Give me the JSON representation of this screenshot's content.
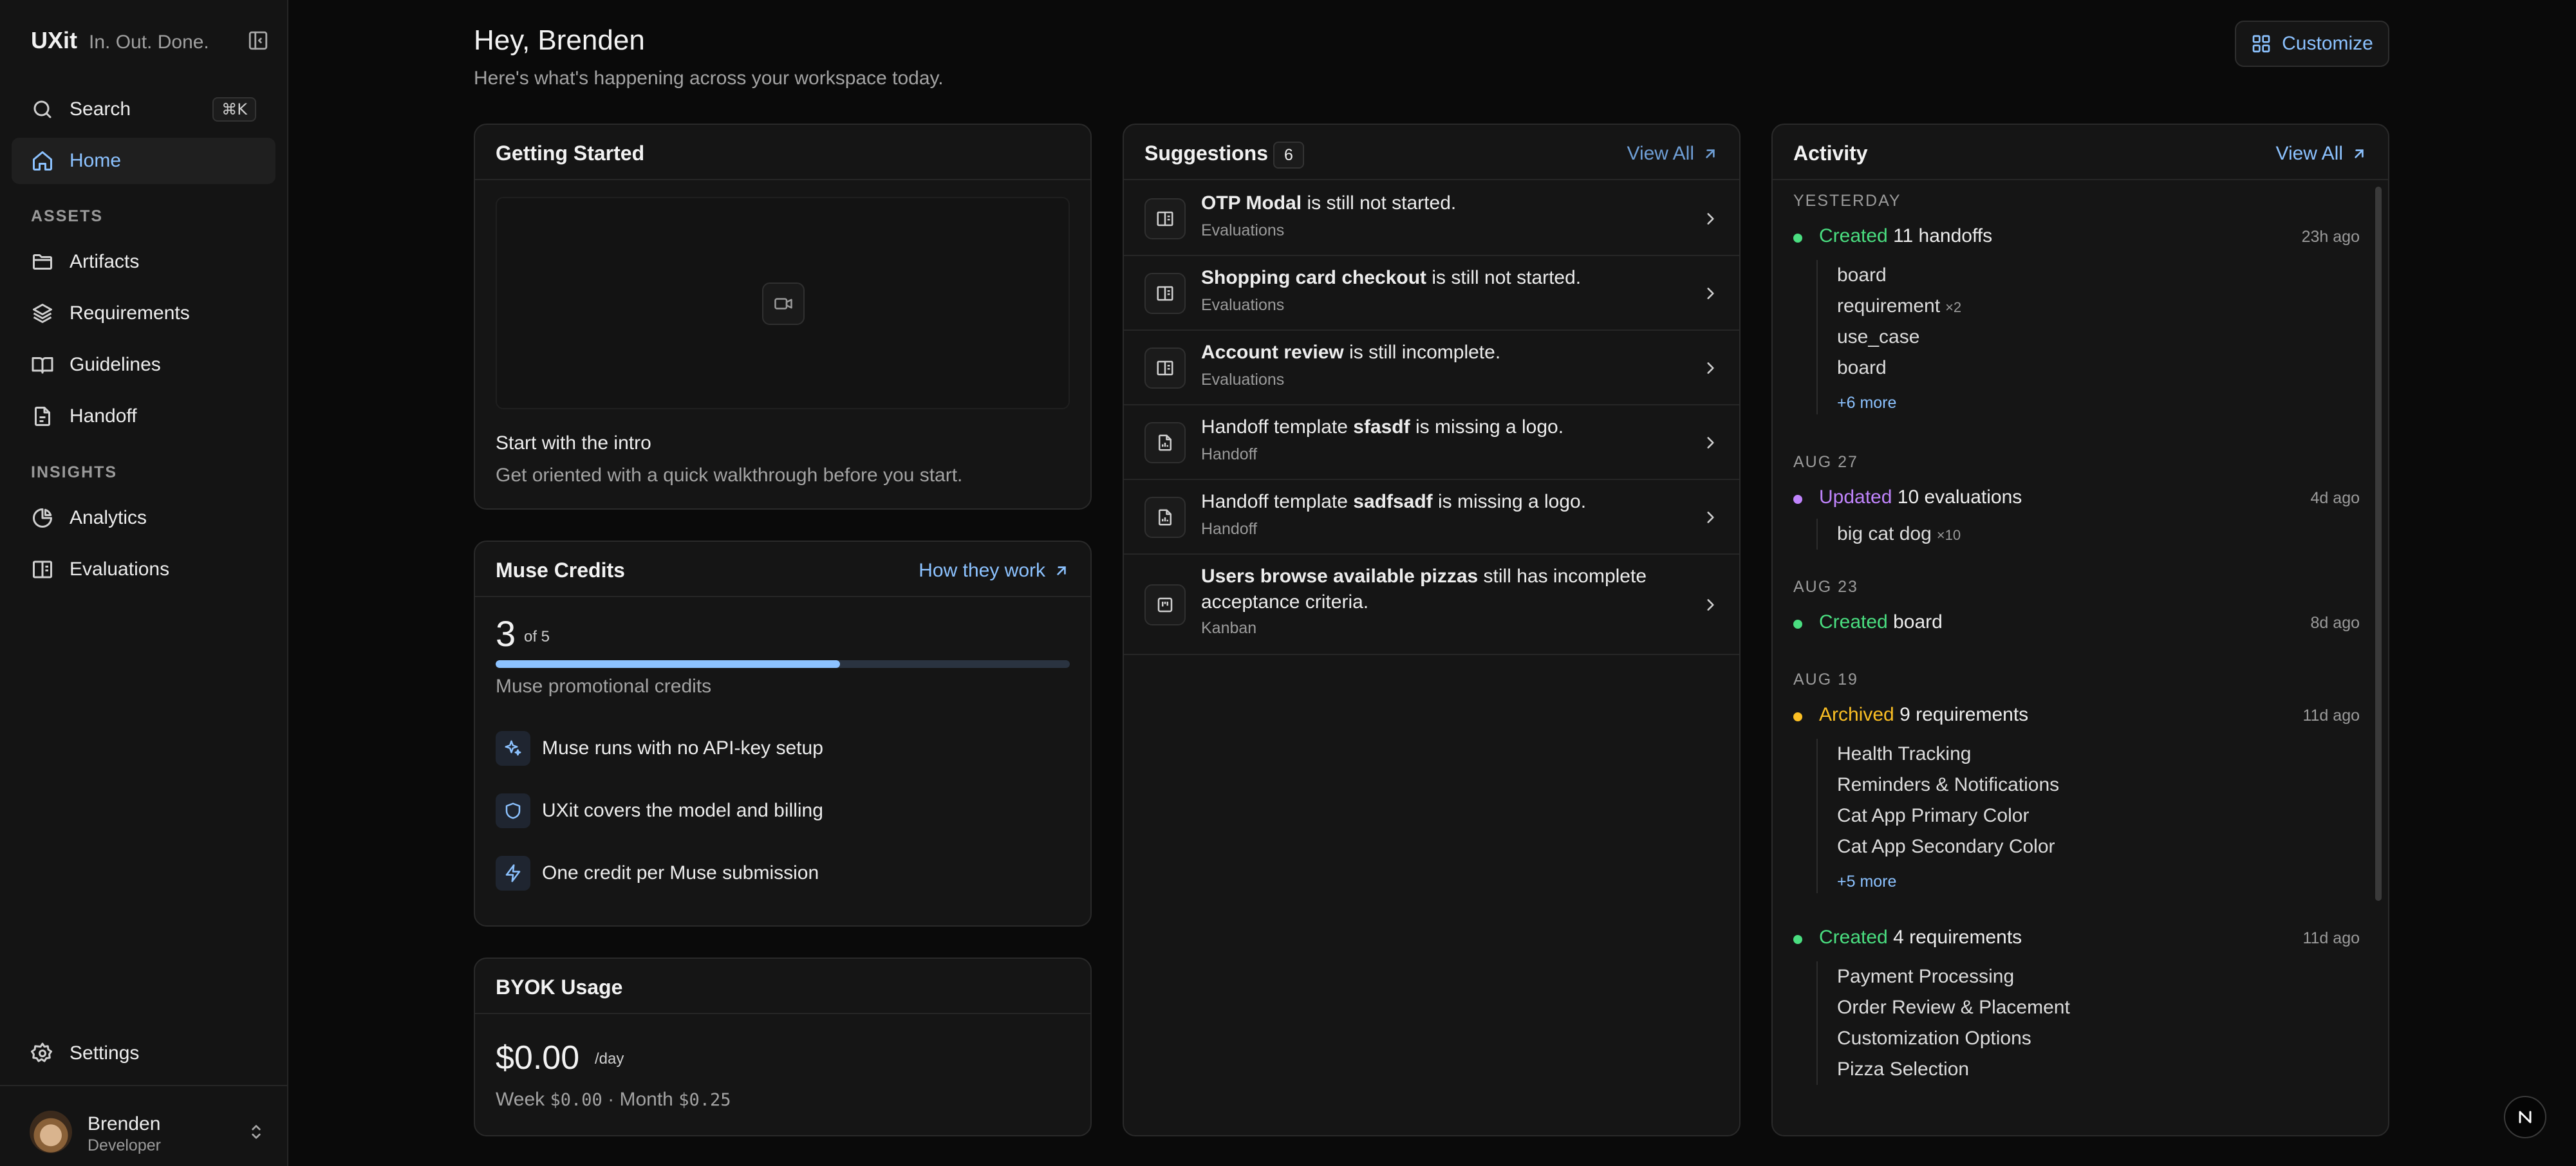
{
  "app": {
    "name": "UXit",
    "tagline": "In. Out. Done."
  },
  "colors": {
    "accent": "#8cc2ff",
    "green": "#4ade80",
    "purple": "#c084fc",
    "amber": "#fbbf24",
    "background": "#0a0a0a",
    "card": "#151515"
  },
  "sidebar": {
    "search": {
      "label": "Search",
      "shortcut": "⌘K",
      "icon": "search-icon"
    },
    "home": {
      "label": "Home",
      "icon": "home-icon"
    },
    "assets_label": "ASSETS",
    "assets": [
      {
        "label": "Artifacts",
        "icon": "folder-icon"
      },
      {
        "label": "Requirements",
        "icon": "layers-icon"
      },
      {
        "label": "Guidelines",
        "icon": "book-icon"
      },
      {
        "label": "Handoff",
        "icon": "file-icon"
      }
    ],
    "insights_label": "INSIGHTS",
    "insights": [
      {
        "label": "Analytics",
        "icon": "pie-chart-icon"
      },
      {
        "label": "Evaluations",
        "icon": "book-open-icon"
      }
    ],
    "settings": {
      "label": "Settings",
      "icon": "gear-icon"
    },
    "user": {
      "name": "Brenden",
      "role": "Developer"
    }
  },
  "header": {
    "greeting": "Hey, Brenden",
    "subtitle": "Here's what's happening across your workspace today.",
    "customize_label": "Customize"
  },
  "getting_started": {
    "title": "Getting Started",
    "intro_title": "Start with the intro",
    "intro_desc": "Get oriented with a quick walkthrough before you start."
  },
  "muse_credits": {
    "title": "Muse Credits",
    "link": "How they work",
    "used": "3",
    "total_text": "of 5",
    "progress_fraction": 0.6,
    "label": "Muse promotional credits",
    "features": [
      {
        "icon": "sparkles-icon",
        "text": "Muse runs with no API-key setup"
      },
      {
        "icon": "shield-icon",
        "text": "UXit covers the model and billing"
      },
      {
        "icon": "bolt-icon",
        "text": "One credit per Muse submission"
      }
    ]
  },
  "byok": {
    "title": "BYOK Usage",
    "amount": "$0.00",
    "per": "/day",
    "week_label": "Week",
    "week_value": "$0.00",
    "separator": "·",
    "month_label": "Month",
    "month_value": "$0.25"
  },
  "suggestions": {
    "title": "Suggestions",
    "count": "6",
    "view_all": "View All",
    "items": [
      {
        "icon": "evaluation-icon",
        "bold": "OTP Modal",
        "rest": " is still not started.",
        "category": "Evaluations"
      },
      {
        "icon": "evaluation-icon",
        "bold": "Shopping card checkout",
        "rest": " is still not started.",
        "category": "Evaluations"
      },
      {
        "icon": "evaluation-icon",
        "bold": "Account review",
        "rest": " is still incomplete.",
        "category": "Evaluations"
      },
      {
        "icon": "file-chart-icon",
        "pre": "Handoff template ",
        "bold": "sfasdf",
        "rest": " is missing a logo.",
        "category": "Handoff"
      },
      {
        "icon": "file-chart-icon",
        "pre": "Handoff template ",
        "bold": "sadfsadf",
        "rest": " is missing a logo.",
        "category": "Handoff"
      },
      {
        "icon": "kanban-icon",
        "bold": "Users browse available pizzas",
        "rest": " still has incomplete acceptance criteria.",
        "category": "Kanban"
      }
    ]
  },
  "activity": {
    "title": "Activity",
    "view_all": "View All",
    "groups": [
      {
        "date": "YESTERDAY",
        "events": [
          {
            "verb": "Created",
            "color": "green",
            "object": "11 handoffs",
            "time": "23h ago",
            "items": [
              {
                "name": "board"
              },
              {
                "name": "requirement",
                "mult": "×2"
              },
              {
                "name": "use_case"
              },
              {
                "name": "board"
              }
            ],
            "more": "+6 more"
          }
        ]
      },
      {
        "date": "AUG 27",
        "events": [
          {
            "verb": "Updated",
            "color": "purple",
            "object": "10 evaluations",
            "time": "4d ago",
            "items": [
              {
                "name": "big cat dog",
                "mult": "×10"
              }
            ]
          }
        ]
      },
      {
        "date": "AUG 23",
        "events": [
          {
            "verb": "Created",
            "color": "green",
            "object": "board",
            "time": "8d ago",
            "items": []
          }
        ]
      },
      {
        "date": "AUG 19",
        "events": [
          {
            "verb": "Archived",
            "color": "amber",
            "object": "9 requirements",
            "time": "11d ago",
            "items": [
              {
                "name": "Health Tracking"
              },
              {
                "name": "Reminders & Notifications"
              },
              {
                "name": "Cat App Primary Color"
              },
              {
                "name": "Cat App Secondary Color"
              }
            ],
            "more": "+5 more"
          },
          {
            "verb": "Created",
            "color": "green",
            "object": "4 requirements",
            "time": "11d ago",
            "items": [
              {
                "name": "Payment Processing"
              },
              {
                "name": "Order Review & Placement"
              },
              {
                "name": "Customization Options"
              },
              {
                "name": "Pizza Selection"
              }
            ]
          }
        ]
      }
    ]
  }
}
